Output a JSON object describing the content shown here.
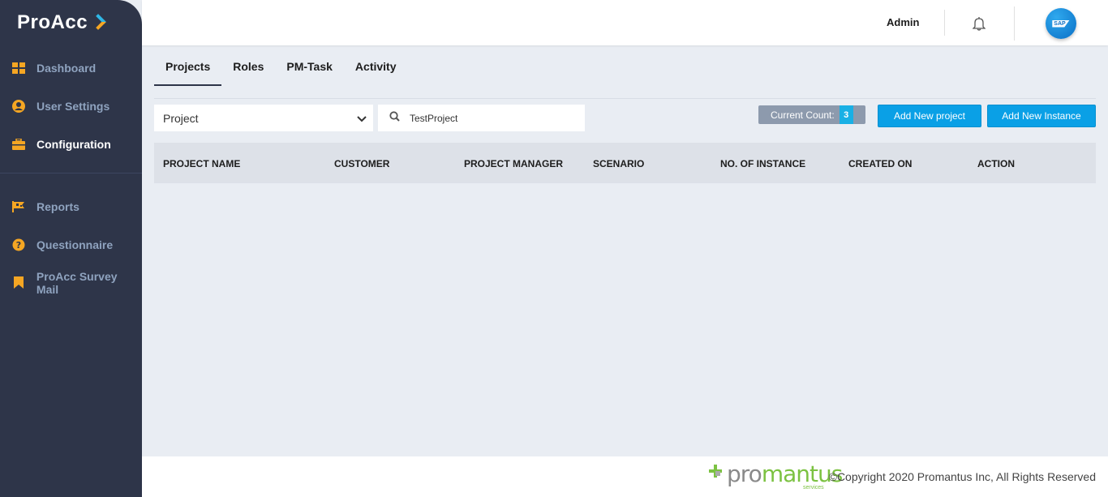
{
  "app": {
    "logo_text": "ProAcc"
  },
  "sidebar": {
    "items": [
      {
        "label": "Dashboard",
        "icon": "dashboard-icon"
      },
      {
        "label": "User Settings",
        "icon": "user-circle-icon"
      },
      {
        "label": "Configuration",
        "icon": "briefcase-icon"
      },
      {
        "label": "Reports",
        "icon": "flag-icon"
      },
      {
        "label": "Questionnaire",
        "icon": "question-circle-icon"
      },
      {
        "label": "ProAcc Survey Mail",
        "icon": "bookmark-icon"
      }
    ],
    "active": "Configuration"
  },
  "header": {
    "user_label": "Admin",
    "notification_icon": "bell-icon",
    "avatar_badge": "SAP"
  },
  "tabs": [
    {
      "label": "Projects",
      "active": true
    },
    {
      "label": "Roles",
      "active": false
    },
    {
      "label": "PM-Task",
      "active": false
    },
    {
      "label": "Activity",
      "active": false
    }
  ],
  "toolbar": {
    "filter_select": {
      "selected": "Project"
    },
    "search": {
      "value": "TestProject"
    },
    "current_count_label": "Current Count:",
    "current_count_value": "3",
    "add_project_label": "Add New project",
    "add_instance_label": "Add New Instance"
  },
  "table": {
    "columns": [
      "PROJECT NAME",
      "CUSTOMER",
      "PROJECT MANAGER",
      "SCENARIO",
      "NO. OF INSTANCE",
      "CREATED ON",
      "ACTION"
    ],
    "rows": []
  },
  "footer": {
    "brand_pro": "pro",
    "brand_mantus": "mantus",
    "brand_sub": "services",
    "copyright": "©Copyright 2020 Promantus Inc, All Rights Reserved"
  },
  "colors": {
    "sidebar_bg": "#2e3549",
    "accent_blue": "#0aa0e6",
    "icon_orange": "#f5a623",
    "content_bg": "#e9edf3"
  }
}
